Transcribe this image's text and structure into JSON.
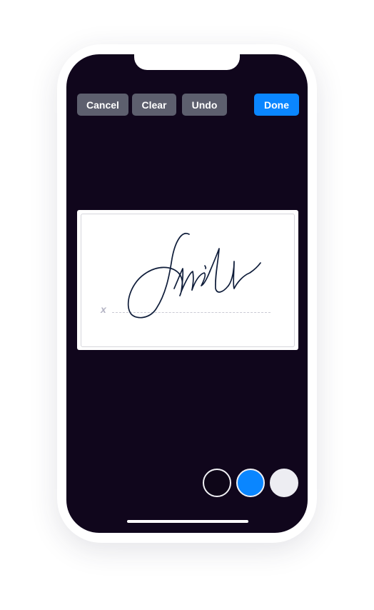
{
  "toolbar": {
    "cancel_label": "Cancel",
    "clear_label": "Clear",
    "undo_label": "Undo",
    "done_label": "Done"
  },
  "signature_pad": {
    "x_marker": "x",
    "drawn_signature": "Smith",
    "ink_color": "#0f1d3a"
  },
  "colors": {
    "accent": "#0a86ff",
    "screen_background": "#10061c",
    "button_grey": "#5d5f6e"
  },
  "color_swatches": [
    {
      "name": "black",
      "color": "#0e0618"
    },
    {
      "name": "blue",
      "color": "#0a86ff"
    },
    {
      "name": "white",
      "color": "#ededf2"
    }
  ]
}
